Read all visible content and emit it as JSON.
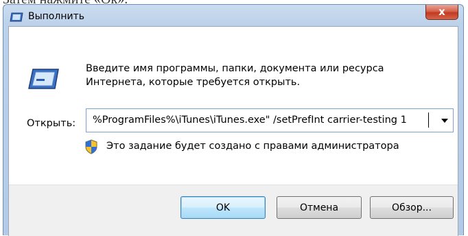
{
  "page_caption": "Затем нажмите «Ок».",
  "window": {
    "title": "Выполнить",
    "close_glyph": "x",
    "icons": {
      "title": "run-icon",
      "main": "run-icon",
      "shield": "uac-shield-icon",
      "dropdown": "chevron-down-icon"
    }
  },
  "dialog": {
    "description_line1": "Введите имя программы, папки, документа или ресурса",
    "description_line2": "Интернета, которые требуется открыть.",
    "open_label": "Открыть:",
    "open_value": "%ProgramFiles%\\iTunes\\iTunes.exe\" /setPrefInt carrier-testing 1",
    "admin_note": "Это задание будет создано с правами администратора"
  },
  "buttons": {
    "ok": "OK",
    "cancel": "Отмена",
    "browse": "Обзор..."
  },
  "colors": {
    "title_gradient": "#bcd1ea",
    "close_button": "#c23a22",
    "default_button": "#bee6fd",
    "footer": "#f0f0f0"
  }
}
